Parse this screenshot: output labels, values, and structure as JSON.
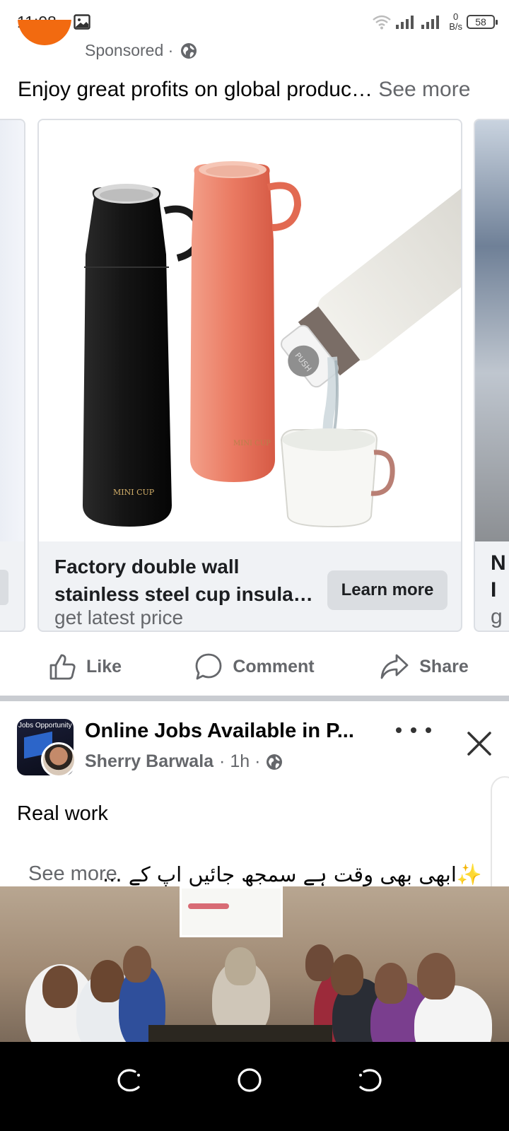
{
  "status_bar": {
    "time": "11:08",
    "speed_value": "0",
    "speed_unit": "B/s",
    "battery": "58",
    "icons": [
      "gallery-icon",
      "wifi-icon",
      "signal-icon",
      "signal-icon"
    ]
  },
  "ad": {
    "sponsored_label": "Sponsored ·",
    "text": "Enjoy great profits on global produc…",
    "see_more": "See more",
    "card": {
      "title_line1": "Factory double wall",
      "title_line2": "stainless steel cup insula…",
      "subtitle": "get latest price",
      "cta": "Learn more",
      "image_labels": [
        "MINI CUP",
        "MINI CUP",
        "PUSH"
      ]
    },
    "next_card_peek": [
      "N",
      "I",
      "g"
    ]
  },
  "actions": {
    "like": "Like",
    "comment": "Comment",
    "share": "Share"
  },
  "post": {
    "avatar_label": "Jobs Opportunity",
    "title": "Online Jobs Available in P...",
    "author": "Sherry Barwala",
    "time": "· 1h ·",
    "body_line1": "Real work",
    "body_line2": "✨ابھی بھی وقت ہے سمجھ جائیں اپ کے ...",
    "see_more": "See more"
  },
  "colors": {
    "accent_orange": "#f26a10",
    "secondary_text": "#65676b",
    "button_bg": "#dadde1",
    "card_bg": "#f0f2f5"
  }
}
